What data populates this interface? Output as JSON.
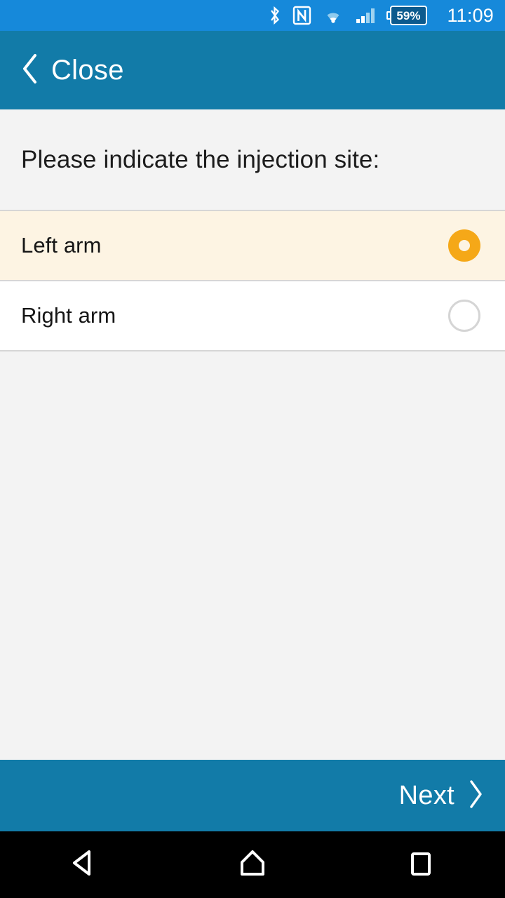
{
  "status_bar": {
    "icons": [
      "bluetooth-icon",
      "nfc-icon",
      "wifi-icon",
      "cellular-signal-icon"
    ],
    "battery_percent": "59%",
    "time": "11:09",
    "background_color": "#1689da"
  },
  "header": {
    "back_icon": "chevron-left-icon",
    "close_label": "Close",
    "background_color": "#127ba8"
  },
  "main": {
    "question": "Please indicate the injection site:",
    "options": [
      {
        "label": "Left arm",
        "selected": true
      },
      {
        "label": "Right arm",
        "selected": false
      }
    ],
    "selected_row_color": "#fdf4e3",
    "radio_selected_color": "#f5a818",
    "radio_unselected_color": "#d5d5d5",
    "background_color": "#f3f3f3"
  },
  "footer": {
    "next_label": "Next",
    "next_icon": "chevron-right-icon",
    "background_color": "#127ba8"
  },
  "navbar": {
    "back": "back-triangle-icon",
    "home": "home-icon",
    "recents": "recents-square-icon"
  }
}
